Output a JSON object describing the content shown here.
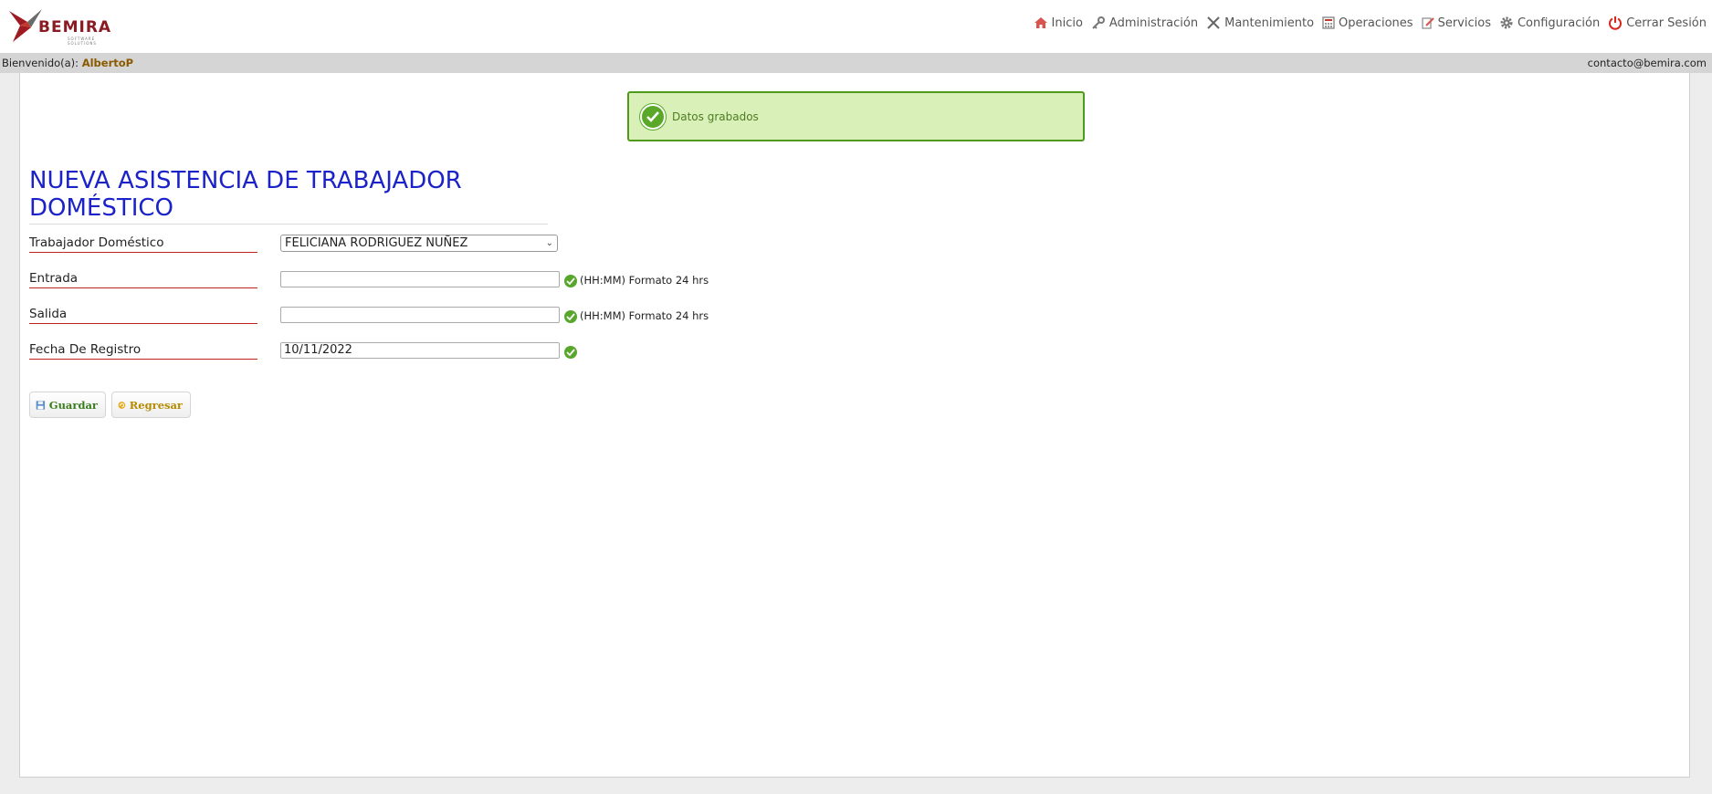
{
  "header": {
    "logo_text": "BEMIRA",
    "logo_subtext": "SOFTWARE SOLUTIONS",
    "nav": [
      {
        "label": "Inicio",
        "icon": "home-icon"
      },
      {
        "label": "Administración",
        "icon": "key-icon"
      },
      {
        "label": "Mantenimiento",
        "icon": "tools-icon"
      },
      {
        "label": "Operaciones",
        "icon": "calculator-icon"
      },
      {
        "label": "Servicios",
        "icon": "edit-document-icon"
      },
      {
        "label": "Configuración",
        "icon": "gear-icon"
      },
      {
        "label": "Cerrar Sesión",
        "icon": "power-icon"
      }
    ]
  },
  "welcome": {
    "prefix": "Bienvenido(a):",
    "user": "AlbertoP",
    "contact": "contacto@bemira.com"
  },
  "alert": {
    "message": "Datos grabados"
  },
  "page": {
    "title": "NUEVA ASISTENCIA DE TRABAJADOR DOMÉSTICO"
  },
  "form": {
    "worker": {
      "label": "Trabajador Doméstico",
      "selected": "FELICIANA RODRIGUEZ NUÑEZ"
    },
    "entrada": {
      "label": "Entrada",
      "value": "",
      "hint": "(HH:MM) Formato 24 hrs"
    },
    "salida": {
      "label": "Salida",
      "value": "",
      "hint": "(HH:MM) Formato 24 hrs"
    },
    "fecha": {
      "label": "Fecha De Registro",
      "value": "10/11/2022"
    }
  },
  "buttons": {
    "save": "Guardar",
    "back": "Regresar"
  },
  "colors": {
    "title": "#1b23c8",
    "label_underline": "#c0231f",
    "success_bg": "#d9f0b9",
    "success_border": "#4f9a1c"
  }
}
